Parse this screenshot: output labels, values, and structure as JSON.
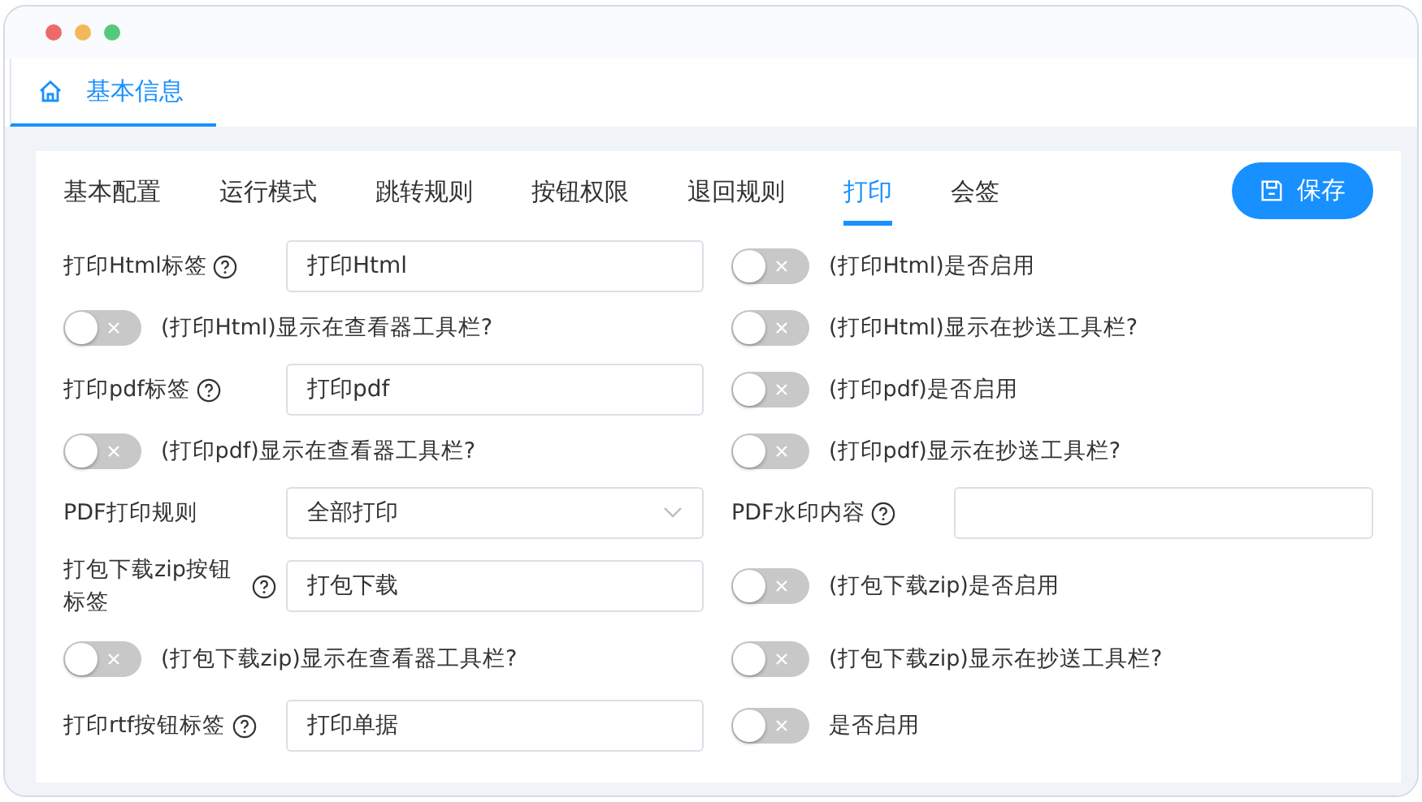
{
  "window_tabs": [
    {
      "label": "基本信息",
      "selected": true
    }
  ],
  "tabs": [
    {
      "label": "基本配置",
      "selected": false
    },
    {
      "label": "运行模式",
      "selected": false
    },
    {
      "label": "跳转规则",
      "selected": false
    },
    {
      "label": "按钮权限",
      "selected": false
    },
    {
      "label": "退回规则",
      "selected": false
    },
    {
      "label": "打印",
      "selected": true
    },
    {
      "label": "会签",
      "selected": false
    }
  ],
  "save_button": "保存",
  "rows": [
    [
      {
        "kind": "input",
        "label": "打印Html标签",
        "help": true,
        "value": "打印Html"
      },
      {
        "kind": "switch",
        "label": "(打印Html)是否启用",
        "on": false
      }
    ],
    [
      {
        "kind": "switch",
        "label": "(打印Html)显示在查看器工具栏?",
        "on": false
      },
      {
        "kind": "switch",
        "label": "(打印Html)显示在抄送工具栏?",
        "on": false
      }
    ],
    [
      {
        "kind": "input",
        "label": "打印pdf标签",
        "help": true,
        "value": "打印pdf"
      },
      {
        "kind": "switch",
        "label": "(打印pdf)是否启用",
        "on": false
      }
    ],
    [
      {
        "kind": "switch",
        "label": "(打印pdf)显示在查看器工具栏?",
        "on": false
      },
      {
        "kind": "switch",
        "label": "(打印pdf)显示在抄送工具栏?",
        "on": false
      }
    ],
    [
      {
        "kind": "select",
        "label": "PDF打印规则",
        "help": false,
        "value": "全部打印"
      },
      {
        "kind": "input",
        "label": "PDF水印内容",
        "help": true
      }
    ],
    [
      {
        "kind": "input",
        "label": "打包下载zip按钮标签",
        "help": true,
        "value": "打包下载"
      },
      {
        "kind": "switch",
        "label": "(打包下载zip)是否启用",
        "on": false
      }
    ],
    [
      {
        "kind": "switch",
        "label": "(打包下载zip)显示在查看器工具栏?",
        "on": false
      },
      {
        "kind": "switch",
        "label": "(打包下载zip)显示在抄送工具栏?",
        "on": false
      }
    ],
    [
      {
        "kind": "input",
        "label": "打印rtf按钮标签",
        "help": true,
        "value": "打印单据"
      },
      {
        "kind": "switch",
        "label": "是否启用",
        "on": false
      }
    ]
  ]
}
